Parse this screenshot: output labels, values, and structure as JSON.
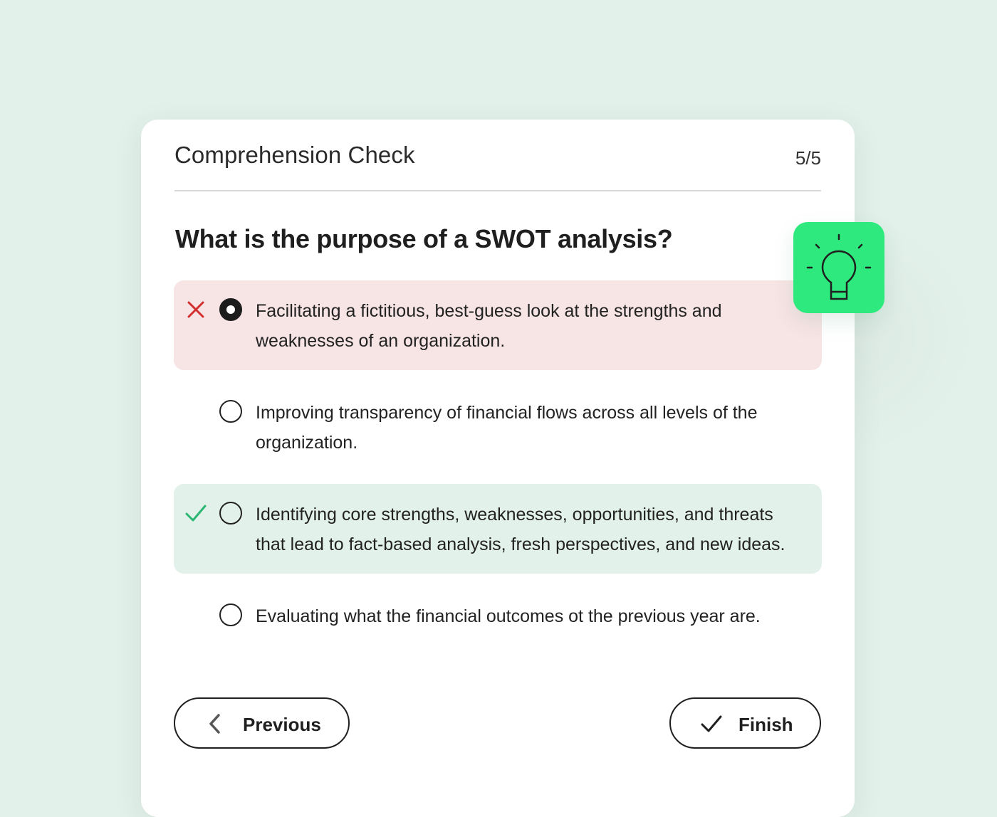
{
  "card": {
    "title": "Comprehension Check",
    "counter": "5/5"
  },
  "question": "What is the purpose of a SWOT analysis?",
  "options": [
    {
      "text": "Facilitating a fictitious, best-guess look at the strengths and weaknesses of an organization.",
      "selected": true,
      "status": "incorrect"
    },
    {
      "text": "Improving transparency of financial flows across all levels of the organization.",
      "selected": false,
      "status": "none"
    },
    {
      "text": "Identifying core strengths, weaknesses, opportunities, and threats that lead to fact-based analysis, fresh perspectives, and new ideas.",
      "selected": false,
      "status": "correct"
    },
    {
      "text": "Evaluating what the financial outcomes ot the previous year are.",
      "selected": false,
      "status": "none"
    }
  ],
  "buttons": {
    "previous_label": "Previous",
    "finish_label": "Finish"
  },
  "icons": {
    "incorrect": "close-icon",
    "correct": "check-icon",
    "previous": "chevron-left-icon",
    "finish": "check-icon",
    "hint": "lightbulb-icon"
  },
  "colors": {
    "background": "#e2f1ea",
    "incorrect_bg": "#f7e4e4",
    "correct_bg": "#e2f1ea",
    "incorrect_mark": "#d32f2f",
    "correct_mark": "#2bb673",
    "hint_accent": "#2eea7e"
  }
}
